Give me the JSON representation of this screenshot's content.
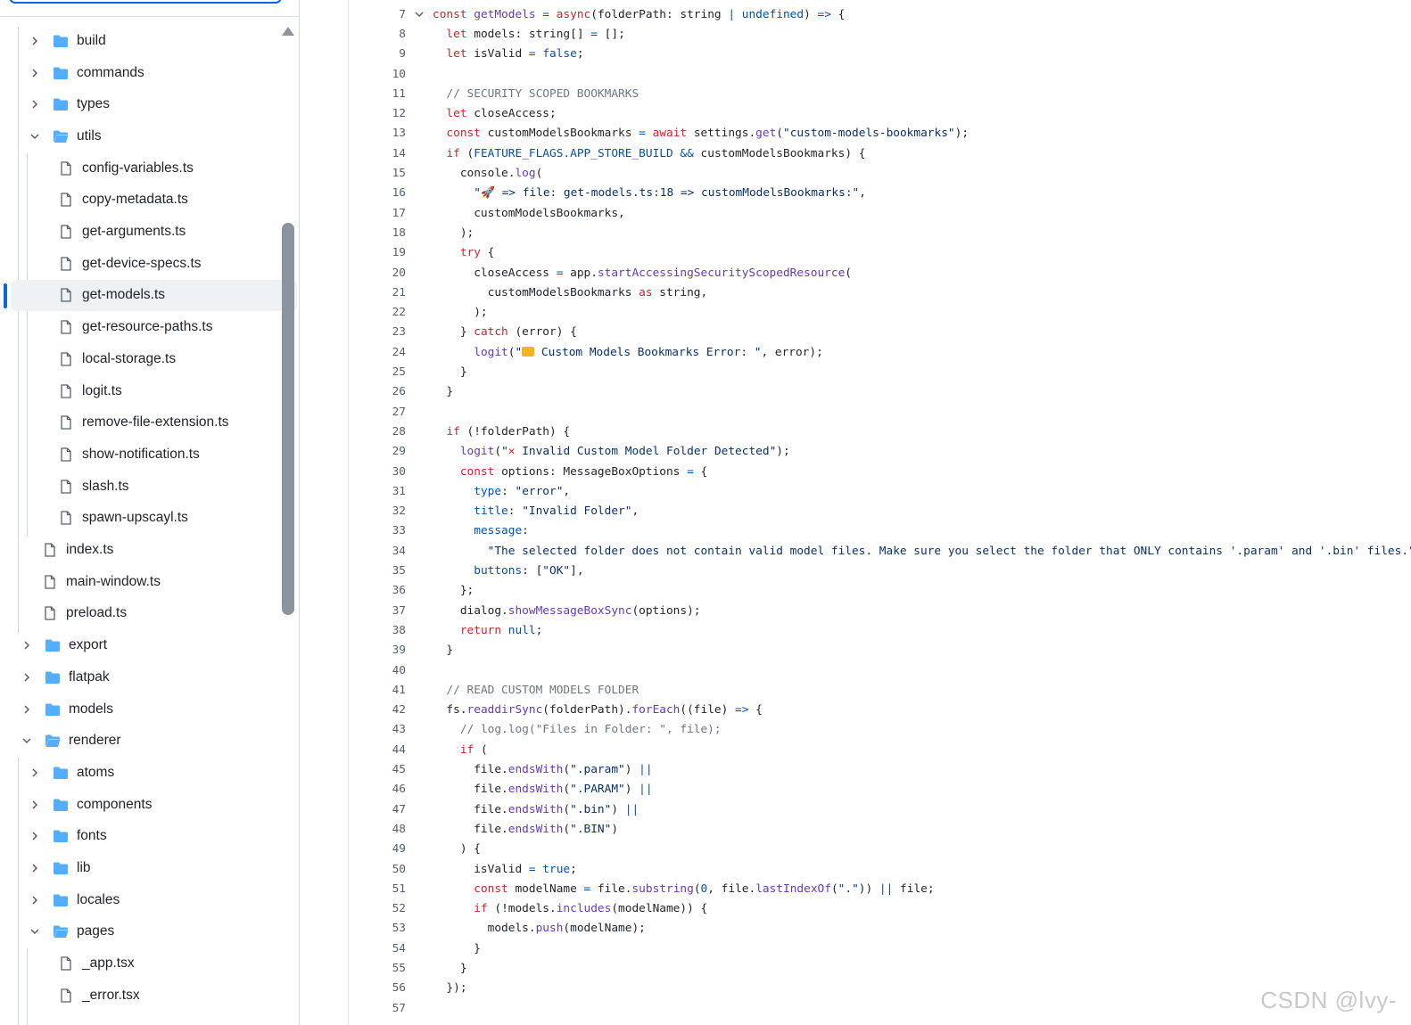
{
  "file_tree": {
    "items": [
      {
        "label": "build",
        "type": "folder",
        "expanded": false,
        "depth": 1
      },
      {
        "label": "commands",
        "type": "folder",
        "expanded": false,
        "depth": 1
      },
      {
        "label": "types",
        "type": "folder",
        "expanded": false,
        "depth": 1
      },
      {
        "label": "utils",
        "type": "folder",
        "expanded": true,
        "depth": 1
      },
      {
        "label": "config-variables.ts",
        "type": "file",
        "depth": 2
      },
      {
        "label": "copy-metadata.ts",
        "type": "file",
        "depth": 2
      },
      {
        "label": "get-arguments.ts",
        "type": "file",
        "depth": 2
      },
      {
        "label": "get-device-specs.ts",
        "type": "file",
        "depth": 2
      },
      {
        "label": "get-models.ts",
        "type": "file",
        "depth": 2,
        "selected": true
      },
      {
        "label": "get-resource-paths.ts",
        "type": "file",
        "depth": 2
      },
      {
        "label": "local-storage.ts",
        "type": "file",
        "depth": 2
      },
      {
        "label": "logit.ts",
        "type": "file",
        "depth": 2
      },
      {
        "label": "remove-file-extension.ts",
        "type": "file",
        "depth": 2
      },
      {
        "label": "show-notification.ts",
        "type": "file",
        "depth": 2
      },
      {
        "label": "slash.ts",
        "type": "file",
        "depth": 2
      },
      {
        "label": "spawn-upscayl.ts",
        "type": "file",
        "depth": 2
      },
      {
        "label": "index.ts",
        "type": "file",
        "depth": 1
      },
      {
        "label": "main-window.ts",
        "type": "file",
        "depth": 1
      },
      {
        "label": "preload.ts",
        "type": "file",
        "depth": 1
      },
      {
        "label": "export",
        "type": "folder",
        "expanded": false,
        "depth": 0
      },
      {
        "label": "flatpak",
        "type": "folder",
        "expanded": false,
        "depth": 0
      },
      {
        "label": "models",
        "type": "folder",
        "expanded": false,
        "depth": 0
      },
      {
        "label": "renderer",
        "type": "folder",
        "expanded": true,
        "depth": 0
      },
      {
        "label": "atoms",
        "type": "folder",
        "expanded": false,
        "depth": 1
      },
      {
        "label": "components",
        "type": "folder",
        "expanded": false,
        "depth": 1
      },
      {
        "label": "fonts",
        "type": "folder",
        "expanded": false,
        "depth": 1
      },
      {
        "label": "lib",
        "type": "folder",
        "expanded": false,
        "depth": 1
      },
      {
        "label": "locales",
        "type": "folder",
        "expanded": false,
        "depth": 1
      },
      {
        "label": "pages",
        "type": "folder",
        "expanded": true,
        "depth": 1
      },
      {
        "label": "_app.tsx",
        "type": "file",
        "depth": 2
      },
      {
        "label": "_error.tsx",
        "type": "file",
        "depth": 2
      }
    ]
  },
  "code": {
    "lines": [
      {
        "n": "7",
        "fold": true,
        "tokens": [
          [
            "kw",
            "const "
          ],
          [
            "fn",
            "getModels"
          ],
          [
            "op",
            " = "
          ],
          [
            "kw",
            "async"
          ],
          [
            "",
            "(folderPath: string "
          ],
          [
            "op",
            "|"
          ],
          [
            "ty",
            " undefined"
          ],
          [
            "",
            ") "
          ],
          [
            "op",
            "=>"
          ],
          [
            "",
            " {"
          ]
        ]
      },
      {
        "n": "8",
        "tokens": [
          [
            "",
            "  "
          ],
          [
            "kw",
            "let"
          ],
          [
            "",
            " models: string[] "
          ],
          [
            "op",
            "="
          ],
          [
            "",
            " [];"
          ]
        ]
      },
      {
        "n": "9",
        "tokens": [
          [
            "",
            "  "
          ],
          [
            "kw",
            "let"
          ],
          [
            "",
            " isValid "
          ],
          [
            "op",
            "="
          ],
          [
            "ty",
            " false"
          ],
          [
            "",
            ";"
          ]
        ]
      },
      {
        "n": "10",
        "tokens": []
      },
      {
        "n": "11",
        "tokens": [
          [
            "",
            "  "
          ],
          [
            "cm",
            "// SECURITY SCOPED BOOKMARKS"
          ]
        ]
      },
      {
        "n": "12",
        "tokens": [
          [
            "",
            "  "
          ],
          [
            "kw",
            "let"
          ],
          [
            "",
            " closeAccess;"
          ]
        ]
      },
      {
        "n": "13",
        "tokens": [
          [
            "",
            "  "
          ],
          [
            "kw",
            "const"
          ],
          [
            "",
            " customModelsBookmarks "
          ],
          [
            "op",
            "="
          ],
          [
            "kw",
            " await"
          ],
          [
            "",
            " settings."
          ],
          [
            "fn",
            "get"
          ],
          [
            "",
            "("
          ],
          [
            "str",
            "\"custom-models-bookmarks\""
          ],
          [
            "",
            ");"
          ]
        ]
      },
      {
        "n": "14",
        "tokens": [
          [
            "",
            "  "
          ],
          [
            "kw",
            "if"
          ],
          [
            "",
            " ("
          ],
          [
            "ty",
            "FEATURE_FLAGS.APP_STORE_BUILD"
          ],
          [
            "op",
            " &&"
          ],
          [
            "",
            " customModelsBookmarks) {"
          ]
        ]
      },
      {
        "n": "15",
        "tokens": [
          [
            "",
            "    console."
          ],
          [
            "fn",
            "log"
          ],
          [
            "",
            "("
          ]
        ]
      },
      {
        "n": "16",
        "tokens": [
          [
            "",
            "      "
          ],
          [
            "str",
            "\""
          ],
          [
            "emoji-rocket",
            "🚀"
          ],
          [
            "str",
            " => file: get-models.ts:18 => customModelsBookmarks:\""
          ],
          [
            "",
            ","
          ]
        ]
      },
      {
        "n": "17",
        "tokens": [
          [
            "",
            "      customModelsBookmarks,"
          ]
        ]
      },
      {
        "n": "18",
        "tokens": [
          [
            "",
            "    );"
          ]
        ]
      },
      {
        "n": "19",
        "tokens": [
          [
            "",
            "    "
          ],
          [
            "kw",
            "try"
          ],
          [
            "",
            " {"
          ]
        ]
      },
      {
        "n": "20",
        "tokens": [
          [
            "",
            "      closeAccess "
          ],
          [
            "op",
            "="
          ],
          [
            "",
            " app."
          ],
          [
            "fn",
            "startAccessingSecurityScopedResource"
          ],
          [
            "",
            "("
          ]
        ]
      },
      {
        "n": "21",
        "tokens": [
          [
            "",
            "        customModelsBookmarks "
          ],
          [
            "kw",
            "as"
          ],
          [
            "",
            " string,"
          ]
        ]
      },
      {
        "n": "22",
        "tokens": [
          [
            "",
            "      );"
          ]
        ]
      },
      {
        "n": "23",
        "tokens": [
          [
            "",
            "    } "
          ],
          [
            "kw",
            "catch"
          ],
          [
            "",
            " (error) {"
          ]
        ]
      },
      {
        "n": "24",
        "tokens": [
          [
            "",
            "      "
          ],
          [
            "fn",
            "logit"
          ],
          [
            "",
            "("
          ],
          [
            "str",
            "\""
          ],
          [
            "emoji-folder",
            ""
          ],
          [
            "str",
            " Custom Models Bookmarks Error: \""
          ],
          [
            "",
            ", error);"
          ]
        ]
      },
      {
        "n": "25",
        "tokens": [
          [
            "",
            "    }"
          ]
        ]
      },
      {
        "n": "26",
        "tokens": [
          [
            "",
            "  }"
          ]
        ]
      },
      {
        "n": "27",
        "tokens": []
      },
      {
        "n": "28",
        "tokens": [
          [
            "",
            "  "
          ],
          [
            "kw",
            "if"
          ],
          [
            "",
            " (!folderPath) {"
          ]
        ]
      },
      {
        "n": "29",
        "tokens": [
          [
            "",
            "    "
          ],
          [
            "fn",
            "logit"
          ],
          [
            "",
            "("
          ],
          [
            "str",
            "\""
          ],
          [
            "emoji-x",
            "✕"
          ],
          [
            "str",
            " Invalid Custom Model Folder Detected\""
          ],
          [
            "",
            ");"
          ]
        ]
      },
      {
        "n": "30",
        "tokens": [
          [
            "",
            "    "
          ],
          [
            "kw",
            "const"
          ],
          [
            "",
            " options: MessageBoxOptions "
          ],
          [
            "op",
            "="
          ],
          [
            "",
            " {"
          ]
        ]
      },
      {
        "n": "31",
        "tokens": [
          [
            "",
            "      "
          ],
          [
            "ty",
            "type"
          ],
          [
            "",
            ": "
          ],
          [
            "str",
            "\"error\""
          ],
          [
            "",
            ","
          ]
        ]
      },
      {
        "n": "32",
        "tokens": [
          [
            "",
            "      "
          ],
          [
            "ty",
            "title"
          ],
          [
            "",
            ": "
          ],
          [
            "str",
            "\"Invalid Folder\""
          ],
          [
            "",
            ","
          ]
        ]
      },
      {
        "n": "33",
        "tokens": [
          [
            "",
            "      "
          ],
          [
            "ty",
            "message"
          ],
          [
            "",
            ":"
          ]
        ]
      },
      {
        "n": "34",
        "tokens": [
          [
            "",
            "        "
          ],
          [
            "str",
            "\"The selected folder does not contain valid model files. Make sure you select the folder that ONLY contains '.param' and '.bin' files.\""
          ],
          [
            "",
            ","
          ]
        ]
      },
      {
        "n": "35",
        "tokens": [
          [
            "",
            "      "
          ],
          [
            "ty",
            "buttons"
          ],
          [
            "",
            ": ["
          ],
          [
            "str",
            "\"OK\""
          ],
          [
            "",
            "],"
          ]
        ]
      },
      {
        "n": "36",
        "tokens": [
          [
            "",
            "    };"
          ]
        ]
      },
      {
        "n": "37",
        "tokens": [
          [
            "",
            "    dialog."
          ],
          [
            "fn",
            "showMessageBoxSync"
          ],
          [
            "",
            "(options);"
          ]
        ]
      },
      {
        "n": "38",
        "tokens": [
          [
            "",
            "    "
          ],
          [
            "kw",
            "return"
          ],
          [
            "ty",
            " null"
          ],
          [
            "",
            ";"
          ]
        ]
      },
      {
        "n": "39",
        "tokens": [
          [
            "",
            "  }"
          ]
        ]
      },
      {
        "n": "40",
        "tokens": []
      },
      {
        "n": "41",
        "tokens": [
          [
            "",
            "  "
          ],
          [
            "cm",
            "// READ CUSTOM MODELS FOLDER"
          ]
        ]
      },
      {
        "n": "42",
        "tokens": [
          [
            "",
            "  fs."
          ],
          [
            "fn",
            "readdirSync"
          ],
          [
            "",
            "(folderPath)."
          ],
          [
            "fn",
            "forEach"
          ],
          [
            "",
            "((file) "
          ],
          [
            "op",
            "=>"
          ],
          [
            "",
            " {"
          ]
        ]
      },
      {
        "n": "43",
        "tokens": [
          [
            "",
            "    "
          ],
          [
            "cm",
            "// log.log(\"Files in Folder: \", file);"
          ]
        ]
      },
      {
        "n": "44",
        "tokens": [
          [
            "",
            "    "
          ],
          [
            "kw",
            "if"
          ],
          [
            "",
            " ("
          ]
        ]
      },
      {
        "n": "45",
        "tokens": [
          [
            "",
            "      file."
          ],
          [
            "fn",
            "endsWith"
          ],
          [
            "",
            "("
          ],
          [
            "str",
            "\".param\""
          ],
          [
            "",
            ") "
          ],
          [
            "op",
            "||"
          ]
        ]
      },
      {
        "n": "46",
        "tokens": [
          [
            "",
            "      file."
          ],
          [
            "fn",
            "endsWith"
          ],
          [
            "",
            "("
          ],
          [
            "str",
            "\".PARAM\""
          ],
          [
            "",
            ") "
          ],
          [
            "op",
            "||"
          ]
        ]
      },
      {
        "n": "47",
        "tokens": [
          [
            "",
            "      file."
          ],
          [
            "fn",
            "endsWith"
          ],
          [
            "",
            "("
          ],
          [
            "str",
            "\".bin\""
          ],
          [
            "",
            ") "
          ],
          [
            "op",
            "||"
          ]
        ]
      },
      {
        "n": "48",
        "tokens": [
          [
            "",
            "      file."
          ],
          [
            "fn",
            "endsWith"
          ],
          [
            "",
            "("
          ],
          [
            "str",
            "\".BIN\""
          ],
          [
            "",
            ")"
          ]
        ]
      },
      {
        "n": "49",
        "tokens": [
          [
            "",
            "    ) {"
          ]
        ]
      },
      {
        "n": "50",
        "tokens": [
          [
            "",
            "      isValid "
          ],
          [
            "op",
            "="
          ],
          [
            "ty",
            " true"
          ],
          [
            "",
            ";"
          ]
        ]
      },
      {
        "n": "51",
        "tokens": [
          [
            "",
            "      "
          ],
          [
            "kw",
            "const"
          ],
          [
            "",
            " modelName "
          ],
          [
            "op",
            "="
          ],
          [
            "",
            " file."
          ],
          [
            "fn",
            "substring"
          ],
          [
            "",
            "("
          ],
          [
            "ty",
            "0"
          ],
          [
            "",
            ", file."
          ],
          [
            "fn",
            "lastIndexOf"
          ],
          [
            "",
            "("
          ],
          [
            "str",
            "\".\""
          ],
          [
            "",
            ")) "
          ],
          [
            "op",
            "||"
          ],
          [
            "",
            " file;"
          ]
        ]
      },
      {
        "n": "52",
        "tokens": [
          [
            "",
            "      "
          ],
          [
            "kw",
            "if"
          ],
          [
            "",
            " (!models."
          ],
          [
            "fn",
            "includes"
          ],
          [
            "",
            "(modelName)) {"
          ]
        ]
      },
      {
        "n": "53",
        "tokens": [
          [
            "",
            "        models."
          ],
          [
            "fn",
            "push"
          ],
          [
            "",
            "(modelName);"
          ]
        ]
      },
      {
        "n": "54",
        "tokens": [
          [
            "",
            "      }"
          ]
        ]
      },
      {
        "n": "55",
        "tokens": [
          [
            "",
            "    }"
          ]
        ]
      },
      {
        "n": "56",
        "tokens": [
          [
            "",
            "  });"
          ]
        ]
      },
      {
        "n": "57",
        "tokens": []
      }
    ]
  },
  "watermark": "CSDN @lvy-",
  "colors": {
    "accent": "#0969da",
    "folder": "#54aeff",
    "selected_row": "#eff2f5"
  }
}
